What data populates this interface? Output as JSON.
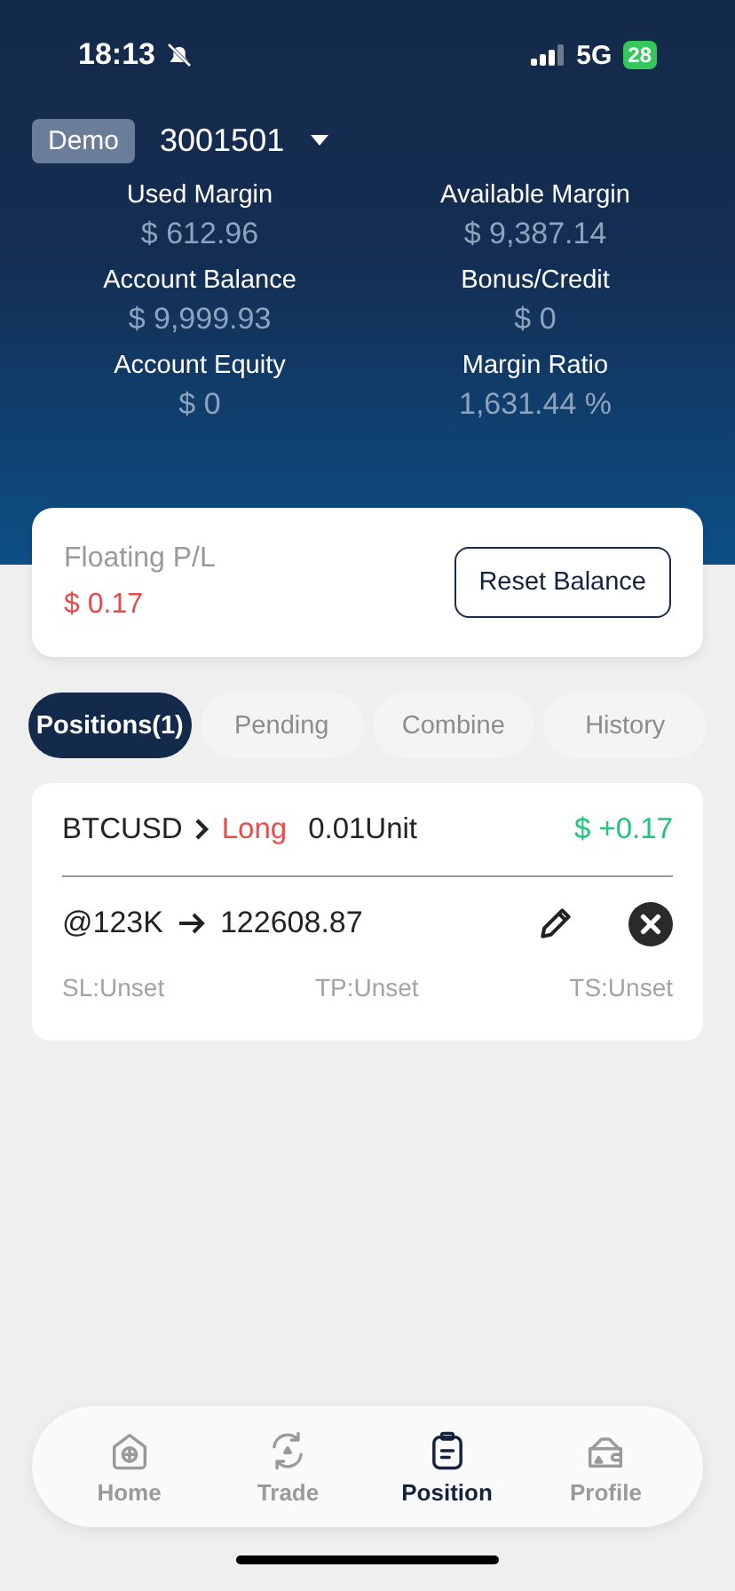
{
  "status_bar": {
    "time": "18:13",
    "network": "5G",
    "battery": "28"
  },
  "account": {
    "badge": "Demo",
    "number": "3001501"
  },
  "stats": [
    {
      "label": "Used Margin",
      "value": "$ 612.96"
    },
    {
      "label": "Available Margin",
      "value": "$ 9,387.14"
    },
    {
      "label": "Account Balance",
      "value": "$ 9,999.93"
    },
    {
      "label": "Bonus/Credit",
      "value": "$ 0"
    },
    {
      "label": "Account Equity",
      "value": "$ 0"
    },
    {
      "label": "Margin Ratio",
      "value": "1,631.44 %"
    }
  ],
  "floating": {
    "label": "Floating P/L",
    "value": "$ 0.17",
    "button": "Reset Balance"
  },
  "tabs": [
    {
      "label": "Positions(1)",
      "selected": true
    },
    {
      "label": "Pending",
      "selected": false
    },
    {
      "label": "Combine",
      "selected": false
    },
    {
      "label": "History",
      "selected": false
    }
  ],
  "positions": [
    {
      "symbol": "BTCUSD",
      "side": "Long",
      "quantity": "0.01Unit",
      "pnl": "$ +0.17",
      "open_price": "@123K",
      "current_price": "122608.87",
      "sl": "SL:Unset",
      "tp": "TP:Unset",
      "ts": "TS:Unset"
    }
  ],
  "nav": [
    {
      "kind": "home",
      "label": "Home",
      "selected": false
    },
    {
      "kind": "trade",
      "label": "Trade",
      "selected": false
    },
    {
      "kind": "position",
      "label": "Position",
      "selected": true
    },
    {
      "kind": "profile",
      "label": "Profile",
      "selected": false
    }
  ]
}
